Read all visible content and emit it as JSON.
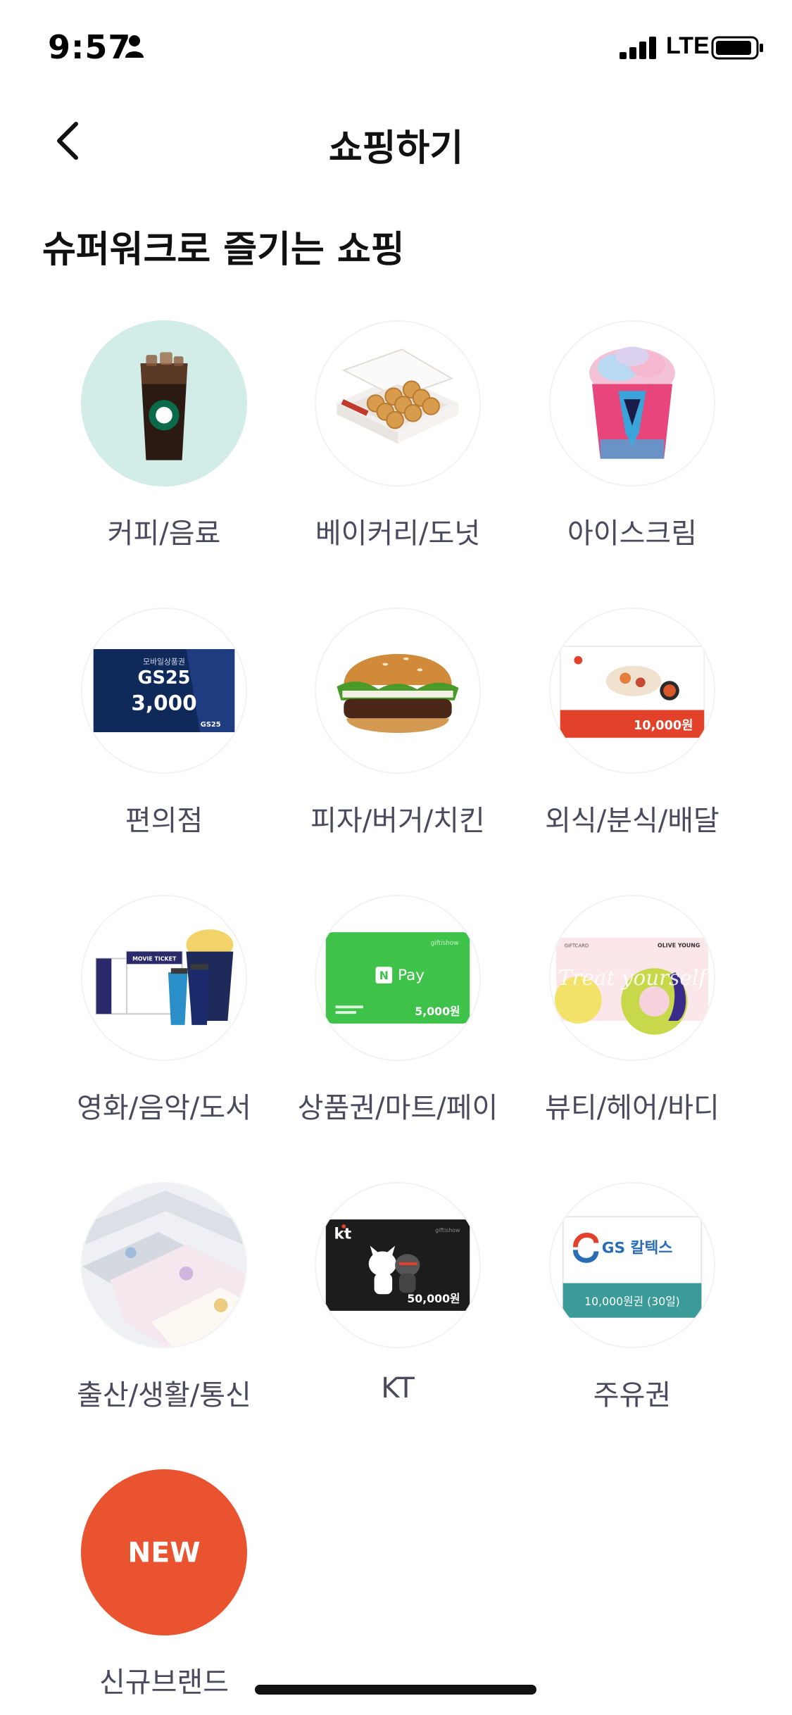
{
  "status_bar": {
    "time": "9:57",
    "network": "LTE",
    "icons": [
      "person-icon",
      "signal-icon",
      "battery-icon"
    ]
  },
  "nav": {
    "title": "쇼핑하기",
    "back_icon": "chevron-left-icon"
  },
  "section": {
    "title": "슈퍼워크로 즐기는 쇼핑"
  },
  "categories": [
    {
      "label": "커피/음료",
      "icon": "iced-coffee-image"
    },
    {
      "label": "베이커리/도넛",
      "icon": "donut-box-image"
    },
    {
      "label": "아이스크림",
      "icon": "ice-cream-cup-image"
    },
    {
      "label": "편의점",
      "icon": "gs25-voucher-image",
      "card_title": "모바일상품권",
      "card_brand": "GS25",
      "card_amount": "3,000",
      "card_footer": "GS25"
    },
    {
      "label": "피자/버거/치킨",
      "icon": "burger-image"
    },
    {
      "label": "외식/분식/배달",
      "icon": "restaurant-voucher-image",
      "card_amount": "10,000원"
    },
    {
      "label": "영화/음악/도서",
      "icon": "movie-ticket-popcorn-image",
      "card_text": "MOVIE TICKET"
    },
    {
      "label": "상품권/마트/페이",
      "icon": "naver-pay-card-image",
      "card_brand": "Pay",
      "card_amount": "5,000원",
      "card_corner": "giftishow"
    },
    {
      "label": "뷰티/헤어/바디",
      "icon": "olive-young-giftcard-image",
      "card_corner": "GIFTCARD",
      "card_brand": "OLIVE YOUNG",
      "card_script": "Treat yourself"
    },
    {
      "label": "출산/생활/통신",
      "icon": "towels-image"
    },
    {
      "label": "KT",
      "icon": "kt-mobile-voucher-image",
      "card_brand": "kt",
      "card_amount": "50,000원",
      "card_corner": "giftishow"
    },
    {
      "label": "주유권",
      "icon": "gs-caltex-voucher-image",
      "card_brand": "GS 칼텍스",
      "card_amount": "10,000원권 (30일)"
    },
    {
      "label": "신규브랜드",
      "icon": "new-badge",
      "badge_text": "NEW"
    }
  ],
  "colors": {
    "new_badge": "#ea5330",
    "label_text": "#4a4a5e",
    "naver_green": "#3fc24a",
    "coffee_bg": "#d2ece7",
    "gs_caltex_teal": "#3a9b98"
  }
}
